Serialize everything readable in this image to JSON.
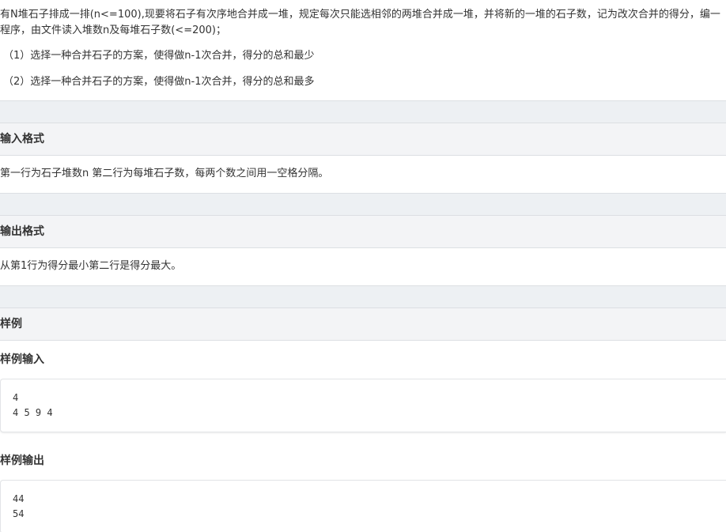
{
  "problem": {
    "description": "有N堆石子排成一排(n<=100),现要将石子有次序地合并成一堆，规定每次只能选相邻的两堆合并成一堆，并将新的一堆的石子数，记为改次合并的得分，编一程序，由文件读入堆数n及每堆石子数(<=200)；",
    "item1": "（1）选择一种合并石子的方案，使得做n-1次合并，得分的总和最少",
    "item2": "（2）选择一种合并石子的方案，使得做n-1次合并，得分的总和最多"
  },
  "input_format": {
    "title": "输入格式",
    "body": "第一行为石子堆数n 第二行为每堆石子数，每两个数之间用一空格分隔。"
  },
  "output_format": {
    "title": "输出格式",
    "body": "从第1行为得分最小第二行是得分最大。"
  },
  "samples": {
    "title": "样例",
    "input_title": "样例输入",
    "input_lines": [
      "4",
      "4 5 9 4"
    ],
    "output_title": "样例输出",
    "output_lines": [
      "44",
      "54"
    ]
  }
}
